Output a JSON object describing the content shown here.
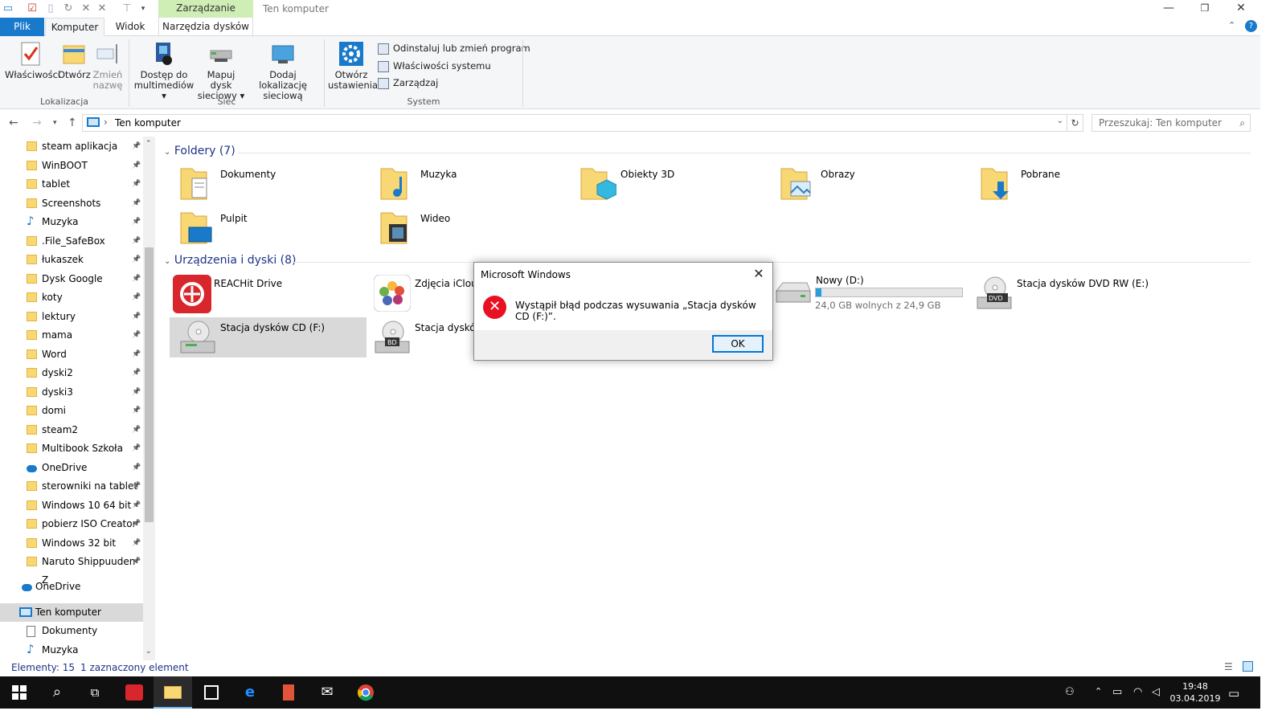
{
  "titlebar": {
    "context_group": "Zarządzanie",
    "title": "Ten komputer"
  },
  "tabs": {
    "file": "Plik",
    "computer": "Komputer",
    "view": "Widok",
    "drive_tools": "Narzędzia dysków"
  },
  "ribbon": {
    "properties": "Właściwości",
    "open": "Otwórz",
    "rename_1": "Zmień",
    "rename_2": "nazwę",
    "group_location": "Lokalizacja",
    "media_1": "Dostęp do",
    "media_2": "multimediów",
    "map_1": "Mapuj dysk",
    "map_2": "sieciowy",
    "addloc_1": "Dodaj lokalizację",
    "addloc_2": "sieciową",
    "group_network": "Sieć",
    "settings_1": "Otwórz",
    "settings_2": "ustawienia",
    "uninstall": "Odinstaluj lub zmień program",
    "sys_props": "Właściwości systemu",
    "manage": "Zarządzaj",
    "group_system": "System"
  },
  "address": {
    "path": "Ten komputer",
    "search_placeholder": "Przeszukaj: Ten komputer"
  },
  "nav": {
    "items": [
      "steam aplikacja",
      "WinBOOT",
      "tablet",
      "Screenshots",
      "Muzyka",
      ".File_SafeBox",
      "łukaszek",
      "Dysk Google",
      "koty",
      "lektury",
      "mama",
      "Word",
      "dyski2",
      "dyski3",
      "domi",
      "steam2",
      "Multibook Szkoła",
      "OneDrive",
      "sterowniki na tablet",
      "Windows 10  64 bit",
      "pobierz ISO Creator",
      "Windows 32 bit",
      "Naruto Shippuuden Z"
    ],
    "onedrive": "OneDrive",
    "this_pc": "Ten komputer",
    "docs": "Dokumenty",
    "music": "Muzyka"
  },
  "content": {
    "folders_header": "Foldery (7)",
    "folders": [
      "Dokumenty",
      "Muzyka",
      "Obiekty 3D",
      "Obrazy",
      "Pobrane",
      "Pulpit",
      "Wideo"
    ],
    "devices_header": "Urządzenia i dyski (8)",
    "devices": {
      "reachit": "REACHit Drive",
      "icloud": "Zdjęcia iCloud",
      "new_d": "Nowy (D:)",
      "new_d_free": "24,0 GB wolnych z 24,9 GB",
      "dvd": "Stacja dysków DVD RW (E:)",
      "cd": "Stacja dysków CD (F:)",
      "bd": "Stacja dysków"
    },
    "disk_d_used_fraction": 0.036
  },
  "dialog": {
    "title": "Microsoft Windows",
    "message": "Wystąpił błąd podczas wysuwania „Stacja dysków CD (F:)”.",
    "ok": "OK"
  },
  "status": {
    "count": "Elementy: 15",
    "selected": "1 zaznaczony element"
  },
  "taskbar": {
    "time": "19:48",
    "date": "03.04.2019"
  },
  "colors": {
    "accent": "#1979ca",
    "ribbon_bg": "#f5f6f7",
    "context_group": "#cfeeb5",
    "error": "#e81123",
    "link_blue": "#1e3287"
  }
}
